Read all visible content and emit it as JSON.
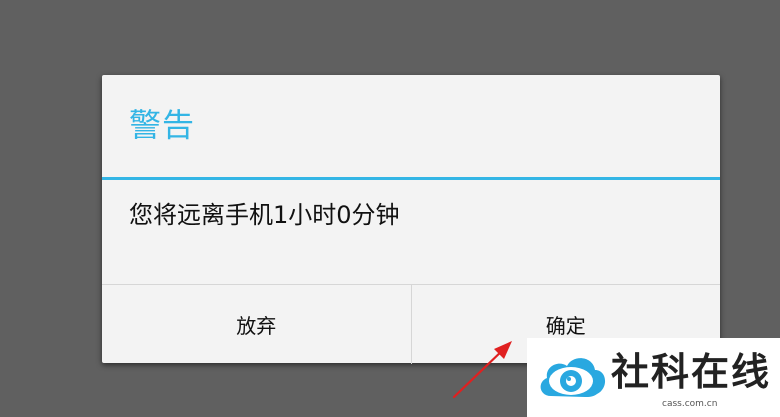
{
  "dialog": {
    "title": "警告",
    "message": "您将远离手机1小时0分钟",
    "negative_button": "放弃",
    "positive_button": "确定"
  },
  "watermark": {
    "name": "社科在线",
    "domain": "cass.com.cn"
  },
  "colors": {
    "backdrop": "#606060",
    "dialog_bg": "#f3f3f3",
    "accent": "#33b5e5",
    "arrow": "#e02020"
  },
  "icons": [
    "red-arrow-icon",
    "cloud-eye-logo-icon"
  ]
}
